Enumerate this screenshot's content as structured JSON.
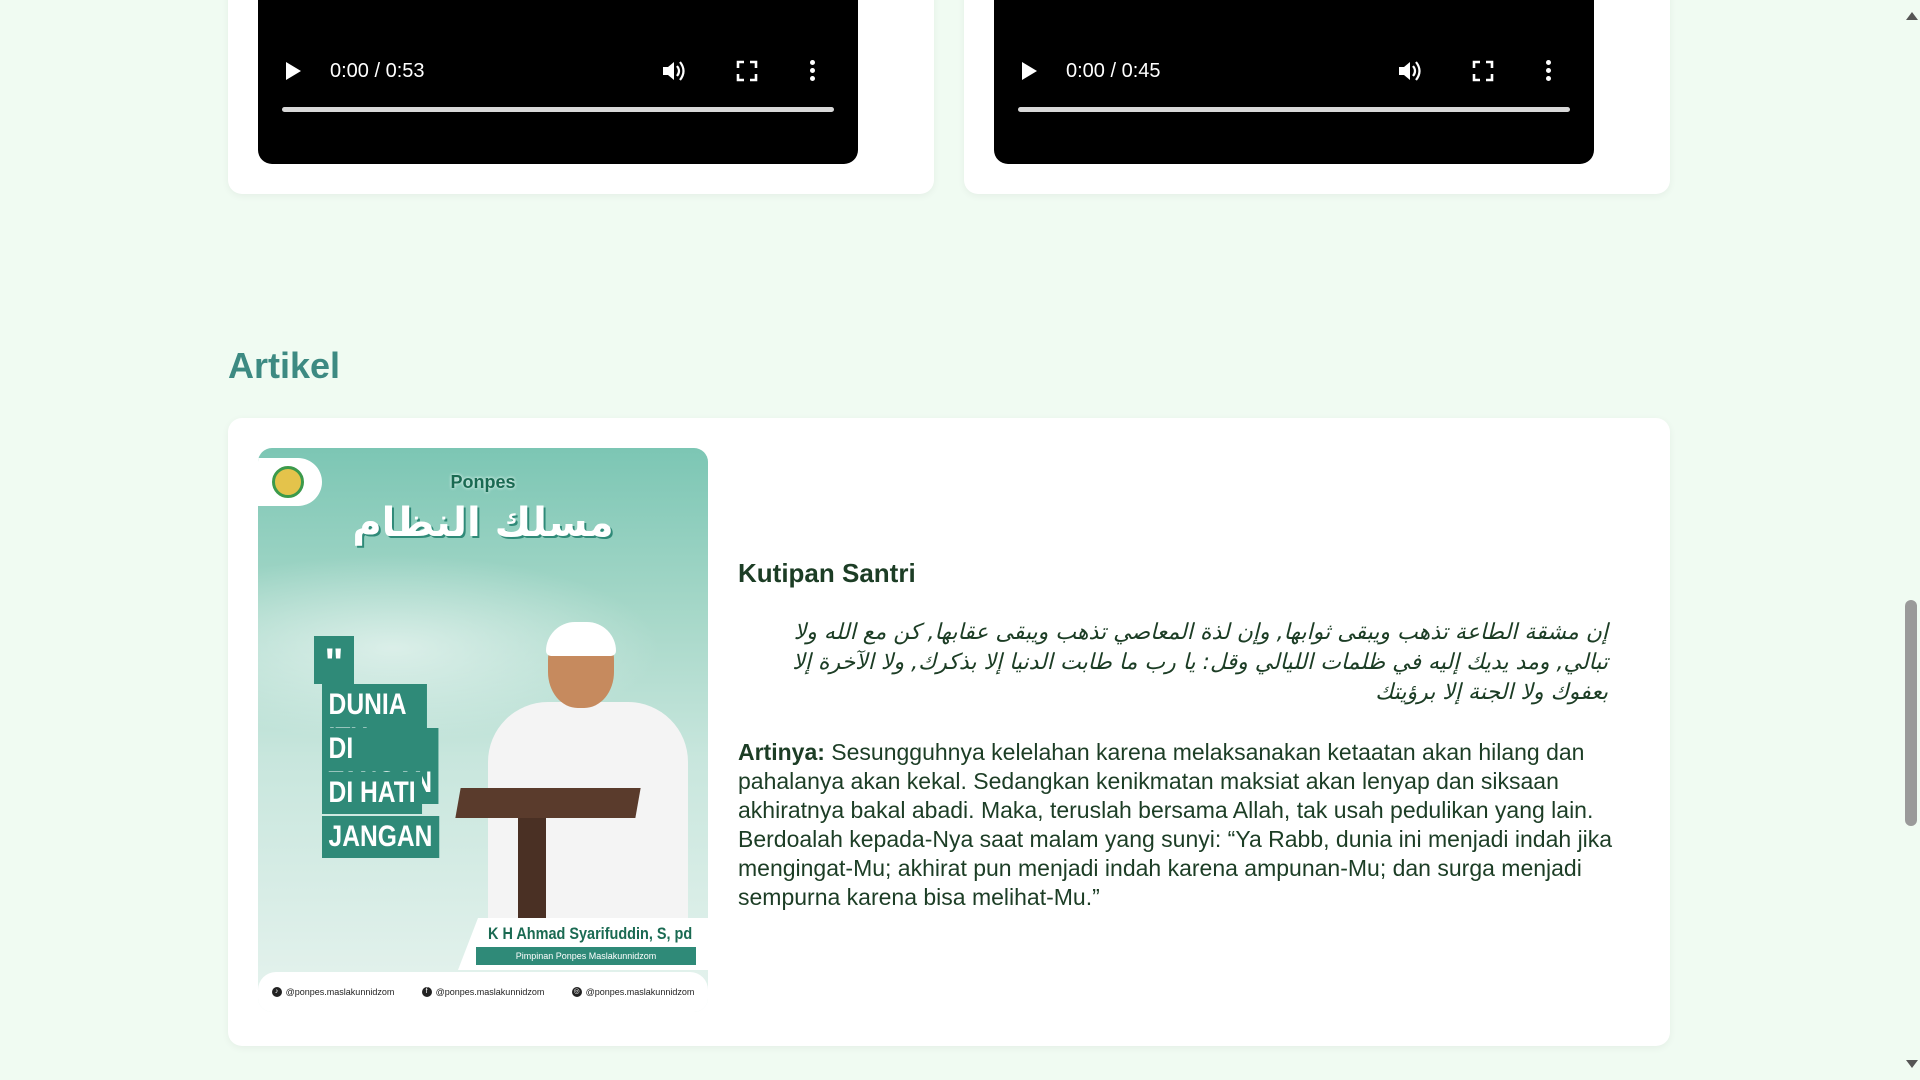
{
  "videos": [
    {
      "time": "0:00 / 0:53"
    },
    {
      "time": "0:00 / 0:45"
    }
  ],
  "section": {
    "title": "Artikel"
  },
  "article": {
    "image": {
      "brand_small": "Ponpes",
      "brand_arabic": "مسلك النظام",
      "quote_mark": "\"",
      "quote_lines": [
        "DUNIA ITU",
        "DI TANGAN",
        "DI HATI",
        "JANGAN"
      ],
      "speaker_name": "K H Ahmad Syarifuddin, S, pd",
      "speaker_role": "Pimpinan Ponpes Maslakunnidzom",
      "socials": [
        "@ponpes.maslakunnidzom",
        "@ponpes.maslakunnidzom",
        "@ponpes.maslakunnidzom"
      ]
    },
    "title": "Kutipan Santri",
    "arabic": "إن مشقة الطاعة تذهب ويبقى ثوابها, وإن لذة المعاصي تذهب ويبقى عقابها, كن مع الله ولا تبالي, ومد يديك إليه في ظلمات الليالي وقل: يا رب ما طابت الدنيا إلا بذكرك, ولا الآخرة إلا بعفوك ولا الجنة إلا برؤيتك",
    "body_label": "Artinya:",
    "body_text": " Sesungguhnya kelelahan karena melaksanakan ketaatan akan hilang dan pahalanya akan kekal. Sedangkan kenikmatan maksiat akan lenyap dan siksaan akhiratnya bakal abadi. Maka, teruslah bersama Allah, tak usah pedulikan yang lain. Berdoalah kepada-Nya saat malam yang sunyi: “Ya Rabb, dunia ini menjadi indah jika mengingat-Mu; akhirat pun menjadi indah karena ampunan-Mu; dan surga menjadi sempurna karena bisa melihat-Mu.”"
  },
  "colors": {
    "background": "#f0fbf2",
    "accent": "#3d8a82",
    "text": "#1c3d25"
  }
}
